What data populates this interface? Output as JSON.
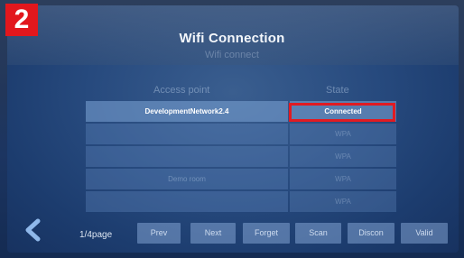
{
  "badge": "2",
  "header": {
    "title": "Wifi Connection",
    "subtitle": "Wifi connect"
  },
  "table": {
    "columns": [
      "Access point",
      "State"
    ],
    "rows": [
      {
        "name": "DevelopmentNetwork2.4",
        "state": "Connected"
      },
      {
        "name": "",
        "state": "WPA"
      },
      {
        "name": "",
        "state": "WPA"
      },
      {
        "name": "Demo room",
        "state": "WPA"
      },
      {
        "name": "",
        "state": "WPA"
      }
    ]
  },
  "footer": {
    "page": "1/4page",
    "buttons": {
      "prev": "Prev",
      "next": "Next",
      "forget": "Forget",
      "scan": "Scan",
      "discon": "Discon",
      "valid": "Valid"
    }
  },
  "colors": {
    "highlight": "#e11b22",
    "badge": "#e2171d",
    "screen": "#274a7e"
  },
  "icons": {
    "back": "chevron-left-icon"
  }
}
